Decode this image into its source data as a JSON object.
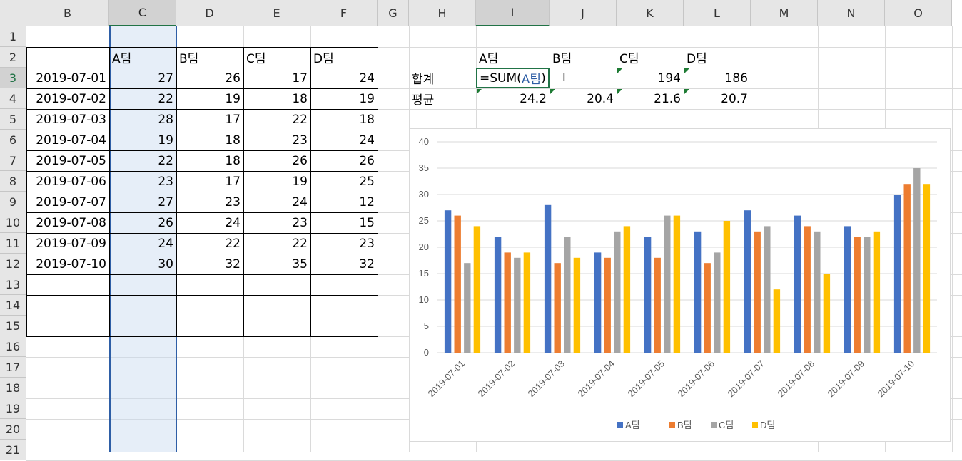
{
  "columns": [
    "B",
    "C",
    "D",
    "E",
    "F",
    "G",
    "H",
    "I",
    "J",
    "K",
    "L",
    "M",
    "N",
    "O"
  ],
  "selected_column": "C",
  "active_column": "I",
  "rows": [
    "1",
    "2",
    "3",
    "4",
    "5",
    "6",
    "7",
    "8",
    "9",
    "10",
    "11",
    "12",
    "13",
    "14",
    "15",
    "16",
    "17",
    "18",
    "19",
    "20",
    "21"
  ],
  "active_row": "3",
  "table": {
    "headers": [
      "A팀",
      "B팀",
      "C팀",
      "D팀"
    ],
    "dates": [
      "2019-07-01",
      "2019-07-02",
      "2019-07-03",
      "2019-07-04",
      "2019-07-05",
      "2019-07-06",
      "2019-07-07",
      "2019-07-08",
      "2019-07-09",
      "2019-07-10"
    ],
    "values": [
      [
        "27",
        "26",
        "17",
        "24"
      ],
      [
        "22",
        "19",
        "18",
        "19"
      ],
      [
        "28",
        "17",
        "22",
        "18"
      ],
      [
        "19",
        "18",
        "23",
        "24"
      ],
      [
        "22",
        "18",
        "26",
        "26"
      ],
      [
        "23",
        "17",
        "19",
        "25"
      ],
      [
        "27",
        "23",
        "24",
        "12"
      ],
      [
        "26",
        "24",
        "23",
        "15"
      ],
      [
        "24",
        "22",
        "22",
        "23"
      ],
      [
        "30",
        "32",
        "35",
        "32"
      ]
    ]
  },
  "summary": {
    "headers": [
      "A팀",
      "B팀",
      "C팀",
      "D팀"
    ],
    "sum_label": "합계",
    "avg_label": "평균",
    "formula_prefix": "=SUM(",
    "formula_ref": "A팀",
    "formula_suffix": ")",
    "sum_values": [
      "",
      "",
      "194",
      "186"
    ],
    "avg_values": [
      "24.2",
      "20.4",
      "21.6",
      "20.7"
    ]
  },
  "chart_data": {
    "type": "bar",
    "categories": [
      "2019-07-01",
      "2019-07-02",
      "2019-07-03",
      "2019-07-04",
      "2019-07-05",
      "2019-07-06",
      "2019-07-07",
      "2019-07-08",
      "2019-07-09",
      "2019-07-10"
    ],
    "series": [
      {
        "name": "A팀",
        "color": "#4472c4",
        "values": [
          27,
          22,
          28,
          19,
          22,
          23,
          27,
          26,
          24,
          30
        ]
      },
      {
        "name": "B팀",
        "color": "#ed7d31",
        "values": [
          26,
          19,
          17,
          18,
          18,
          17,
          23,
          24,
          22,
          32
        ]
      },
      {
        "name": "C팀",
        "color": "#a5a5a5",
        "values": [
          17,
          18,
          22,
          23,
          26,
          19,
          24,
          23,
          22,
          35
        ]
      },
      {
        "name": "D팀",
        "color": "#ffc000",
        "values": [
          24,
          19,
          18,
          24,
          26,
          25,
          12,
          15,
          23,
          32
        ]
      }
    ],
    "ylim": [
      0,
      40
    ],
    "yticks": [
      0,
      5,
      10,
      15,
      20,
      25,
      30,
      35,
      40
    ],
    "grid": true,
    "legend": "bottom"
  }
}
